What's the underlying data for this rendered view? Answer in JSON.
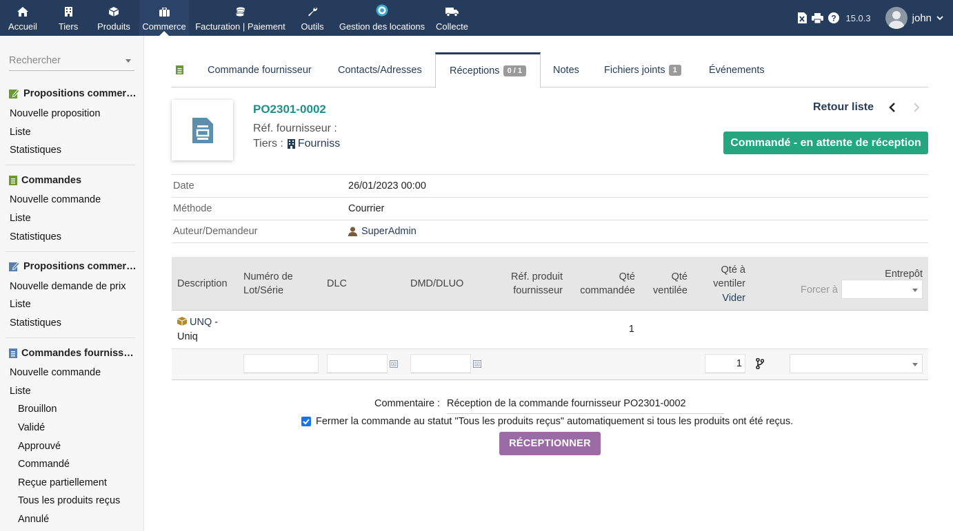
{
  "topnav": {
    "items": [
      {
        "label": "Accueil",
        "icon": "home-icon"
      },
      {
        "label": "Tiers",
        "icon": "building-icon"
      },
      {
        "label": "Produits",
        "icon": "cube-icon"
      },
      {
        "label": "Commerce",
        "icon": "briefcase-icon"
      },
      {
        "label": "Facturation | Paiement",
        "icon": "coins-icon"
      },
      {
        "label": "Outils",
        "icon": "wrench-icon"
      },
      {
        "label": "Gestion des locations",
        "icon": "rental-icon"
      },
      {
        "label": "Collecte",
        "icon": "truck-icon"
      }
    ],
    "active": "Commerce",
    "version": "15.0.3",
    "user": "john"
  },
  "sidebar": {
    "search_placeholder": "Rechercher",
    "sections": [
      {
        "title": "Propositions commerciales",
        "items": [
          "Nouvelle proposition",
          "Liste",
          "Statistiques"
        ]
      },
      {
        "title": "Commandes",
        "items": [
          "Nouvelle commande",
          "Liste",
          "Statistiques"
        ]
      },
      {
        "title": "Propositions commerciales fournisseurs",
        "items": [
          "Nouvelle demande de prix",
          "Liste",
          "Statistiques"
        ]
      },
      {
        "title": "Commandes fournisseurs",
        "items": [
          "Nouvelle commande",
          "Liste"
        ],
        "subitems": [
          "Brouillon",
          "Validé",
          "Approuvé",
          "Commandé",
          "Reçue partiellement",
          "Tous les produits reçus",
          "Annulé"
        ]
      }
    ]
  },
  "tabs": [
    {
      "label": "Commande fournisseur"
    },
    {
      "label": "Contacts/Adresses"
    },
    {
      "label": "Réceptions",
      "badge": "0 / 1",
      "active": true
    },
    {
      "label": "Notes"
    },
    {
      "label": "Fichiers joints",
      "badge": "1"
    },
    {
      "label": "Événements"
    }
  ],
  "header": {
    "ref": "PO2301-0002",
    "ref_fournisseur_label": "Réf. fournisseur :",
    "tiers_label": "Tiers :",
    "tiers_name": "Fourniss",
    "back_label": "Retour liste",
    "status": "Commandé - en attente de réception",
    "status_color": "#25a580"
  },
  "fields": [
    {
      "label": "Date",
      "value": "26/01/2023 00:00"
    },
    {
      "label": "Méthode",
      "value": "Courrier"
    },
    {
      "label": "Auteur/Demandeur",
      "value": "SuperAdmin"
    }
  ],
  "table": {
    "headers": {
      "description": "Description",
      "lot": "Numéro de Lot/Série",
      "dlc": "DLC",
      "dmd": "DMD/DLUO",
      "ref_produit": "Réf. produit fournisseur",
      "qty_ordered": "Qté commandée",
      "qty_dispatched": "Qté ventilée",
      "qty_to_dispatch": "Qté à ventiler",
      "clear": "Vider",
      "warehouse": "Entrepôt",
      "force_label": "Forcer à"
    },
    "rows": [
      {
        "product_ref": "UNQ",
        "product_sep": " - ",
        "product_label": "Uniq",
        "qty_ordered": "1",
        "qty_input": "1"
      }
    ]
  },
  "footer": {
    "comment_label": "Commentaire :",
    "comment_value": "Réception de la commande fournisseur PO2301-0002",
    "close_checkbox_label": "Fermer la commande au statut \"Tous les produits reçus\" automatiquement si tous les produits ont été reçus.",
    "close_checked": true,
    "submit_label": "RÉCEPTIONNER"
  },
  "colors": {
    "topbar": "#263c5c",
    "link": "#263c5c",
    "ref": "#1e8f8f",
    "submit": "#9a6ba5",
    "icon_green": "#6a9a2a"
  }
}
